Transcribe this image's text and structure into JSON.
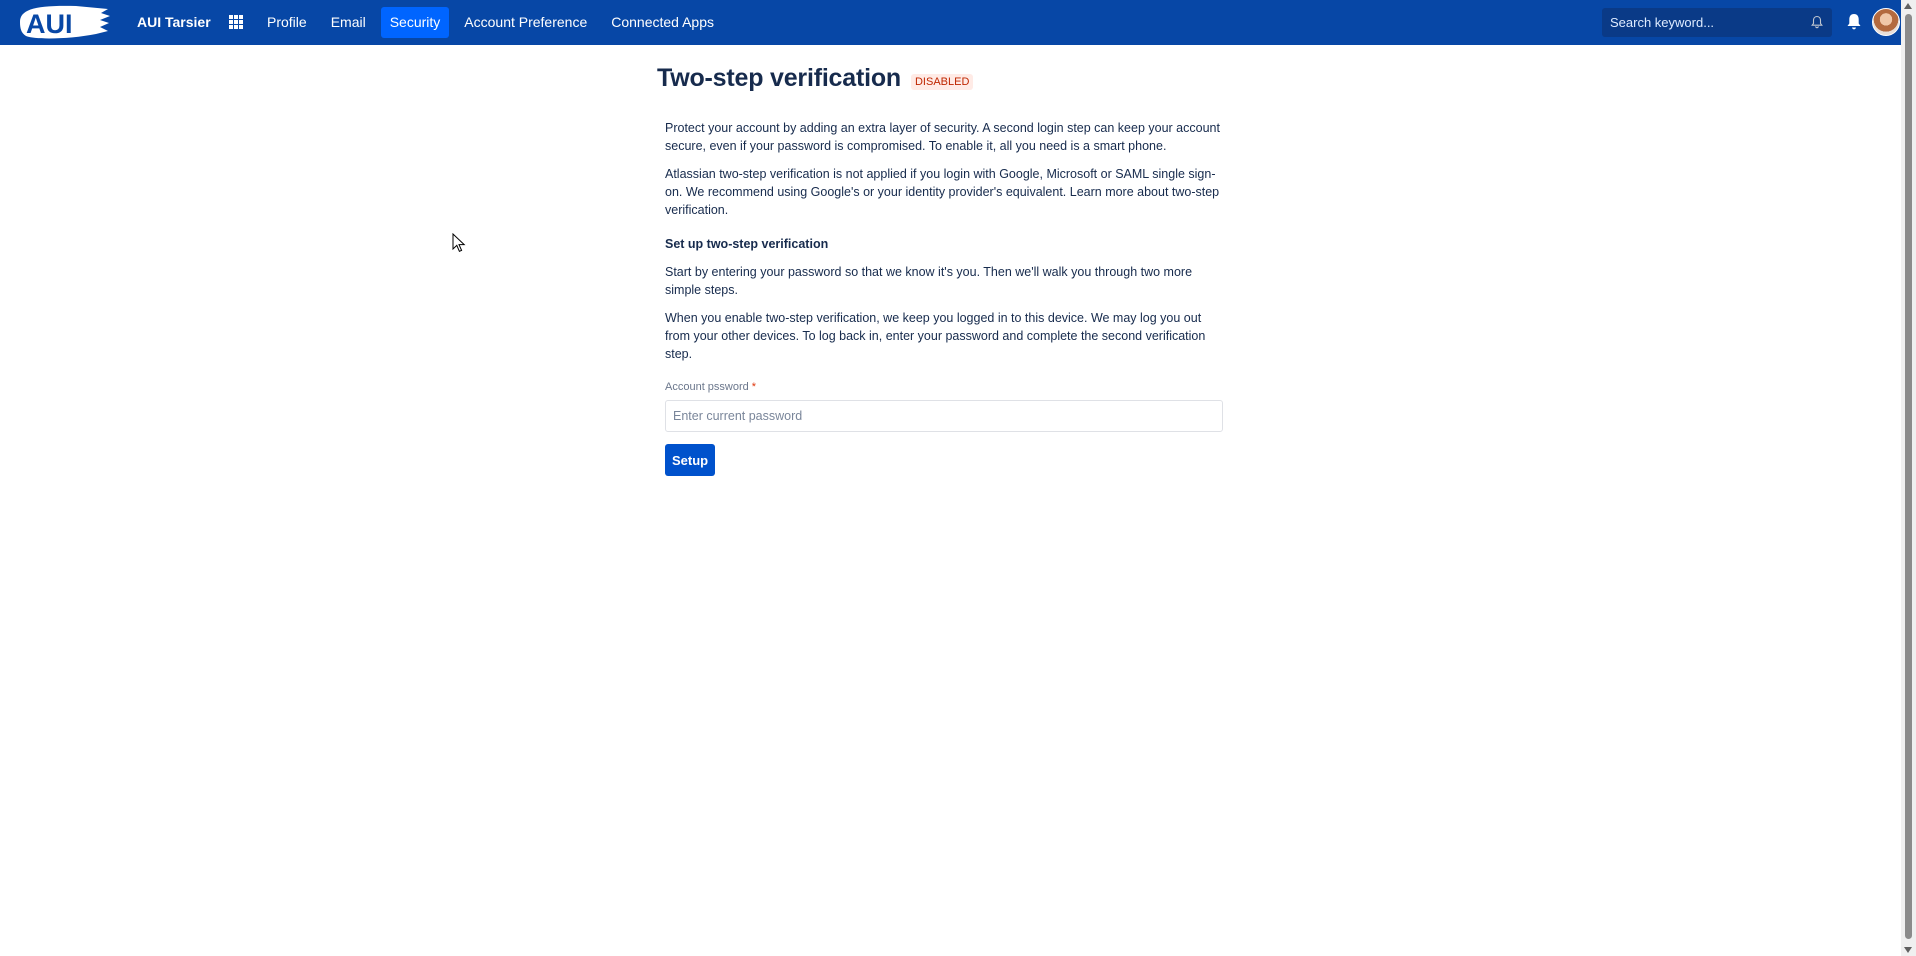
{
  "header": {
    "logo_text": "AUI",
    "app_name": "AUI Tarsier",
    "nav": [
      {
        "label": "Profile",
        "active": false
      },
      {
        "label": "Email",
        "active": false
      },
      {
        "label": "Security",
        "active": true
      },
      {
        "label": "Account Preference",
        "active": false
      },
      {
        "label": "Connected Apps",
        "active": false
      }
    ],
    "search_placeholder": "Search keyword..."
  },
  "page": {
    "title": "Two-step verification",
    "status_badge": "DISABLED",
    "paragraphs": [
      "Protect your account by adding an extra layer of security. A second login step can keep your account secure, even if your password is compromised. To enable it, all you need is a smart phone.",
      "Atlassian two-step verification is not applied if you login with Google, Microsoft or SAML single sign-on. We recommend using Google's or your identity provider's equivalent. Learn more about two-step verification."
    ],
    "setup_heading": "Set up two-step verification",
    "setup_paragraphs": [
      "Start by entering your password so that we know it's you. Then we'll walk you through two more simple steps.",
      "When you enable two-step verification, we keep you logged in to this device. We may log you out from your other devices. To log back in, enter your password and complete the second verification step."
    ],
    "password_label": "Account pssword",
    "required_marker": "*",
    "password_placeholder": "Enter current password",
    "setup_button": "Setup"
  },
  "colors": {
    "header_bg": "#0747a6",
    "nav_active": "#0065ff",
    "badge_bg": "#ffebe6",
    "badge_text": "#bf2600",
    "primary_button": "#0052cc"
  },
  "icons": [
    "app-switcher-icon",
    "bell-icon",
    "notification-icon",
    "cursor-icon"
  ]
}
